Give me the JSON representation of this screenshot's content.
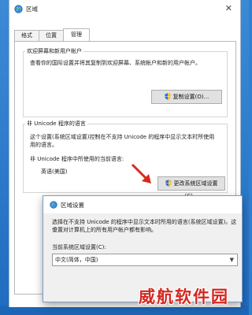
{
  "window": {
    "title": "区域",
    "close_glyph": "✕",
    "tabs": [
      {
        "label": "格式"
      },
      {
        "label": "位置"
      },
      {
        "label": "管理"
      }
    ]
  },
  "welcome_group": {
    "title": "欢迎屏幕和新用户帐户",
    "description": "查看你的国际设置并将其复制到欢迎屏幕、系统帐户和新的用户帐户。",
    "button": "复制设置(O)..."
  },
  "unicode_group": {
    "title": "非 Unicode 程序的语言",
    "description_line1": "这个设置(系统区域设置)控制在不支持 Unicode 的程序中显示文本时所使用",
    "description_line2": "用的语言。",
    "current_label": "非 Unicode 程序中所使用的当前语言:",
    "current_value": "英语(美国)",
    "button": "更改系统区域设置(C)..."
  },
  "dialog": {
    "title": "区域设置",
    "description_line1": "选择在不支持 Unicode 的程序中显示文本时所用的语言(系统区域设置)。这个",
    "description_line2": "设置对计算机上的所有用户帐户都有影响。",
    "select_label": "当前系统区域设置(C):",
    "select_value": "中文(简体，中国)"
  },
  "icons": {
    "globe": "globe-icon",
    "shield": "uac-shield-icon",
    "pointer": "red-arrow-icon"
  },
  "colors": {
    "accent_arrow": "#d62a20",
    "watermark": "#d4271f"
  },
  "watermark": "威航软件园"
}
